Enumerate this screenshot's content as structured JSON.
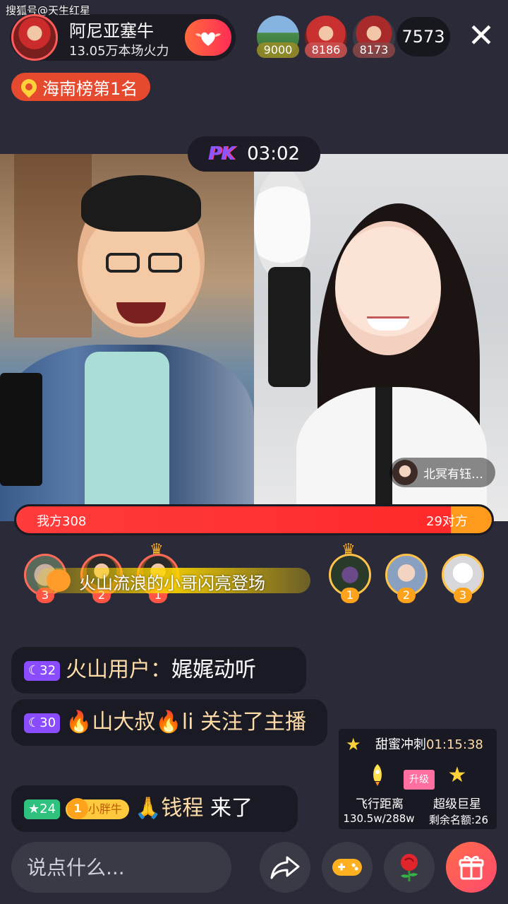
{
  "watermark": "搜狐号@天生红星",
  "host": {
    "name": "阿尼亚塞牛",
    "fire": "13.05万本场火力"
  },
  "viewers": [
    {
      "score": "9000",
      "color": "#3f8c5a"
    },
    {
      "score": "8186",
      "color": "#b84a4a"
    },
    {
      "score": "8173",
      "color": "#5a5a6a"
    }
  ],
  "viewer_count": "7573",
  "close_label": "✕",
  "rank_badge": "海南榜第1名",
  "pk": {
    "logo": "PK",
    "time": "03:02"
  },
  "opponent_caption": "北冥有钰…",
  "score": {
    "our_label": "我方308",
    "their_label": "29对方",
    "our_value": 308,
    "their_value": 29
  },
  "contributors_a": [
    {
      "rank": "3"
    },
    {
      "rank": "2"
    },
    {
      "rank": "1",
      "crown": "♛"
    }
  ],
  "contributors_b": [
    {
      "rank": "1",
      "crown": "♛"
    },
    {
      "rank": "2"
    },
    {
      "rank": "3"
    }
  ],
  "entry_banner": "火山流浪的小哥闪亮登场",
  "chat": [
    {
      "level": "☾32",
      "user": "火山用户：",
      "text": "娓娓动听"
    },
    {
      "level": "☾30",
      "user": "🔥山大叔🔥li",
      "text": "关注了主播"
    },
    {
      "level": "★24",
      "fan_badge": "小胖牛",
      "user": "🙏钱程",
      "text": "来了"
    }
  ],
  "sweet_dash": {
    "title": "甜蜜冲刺",
    "timer": "01:15:38",
    "left_label": "飞行距离",
    "left_sub": "130.5w/288w",
    "upgrade": "升级",
    "right_label": "超级巨星",
    "right_sub": "剩余名额:26"
  },
  "input_placeholder": "说点什么...",
  "colors": {
    "accent": "#ff3b3b",
    "opponent": "#ff9a1c",
    "panel": "#2b2a38"
  }
}
